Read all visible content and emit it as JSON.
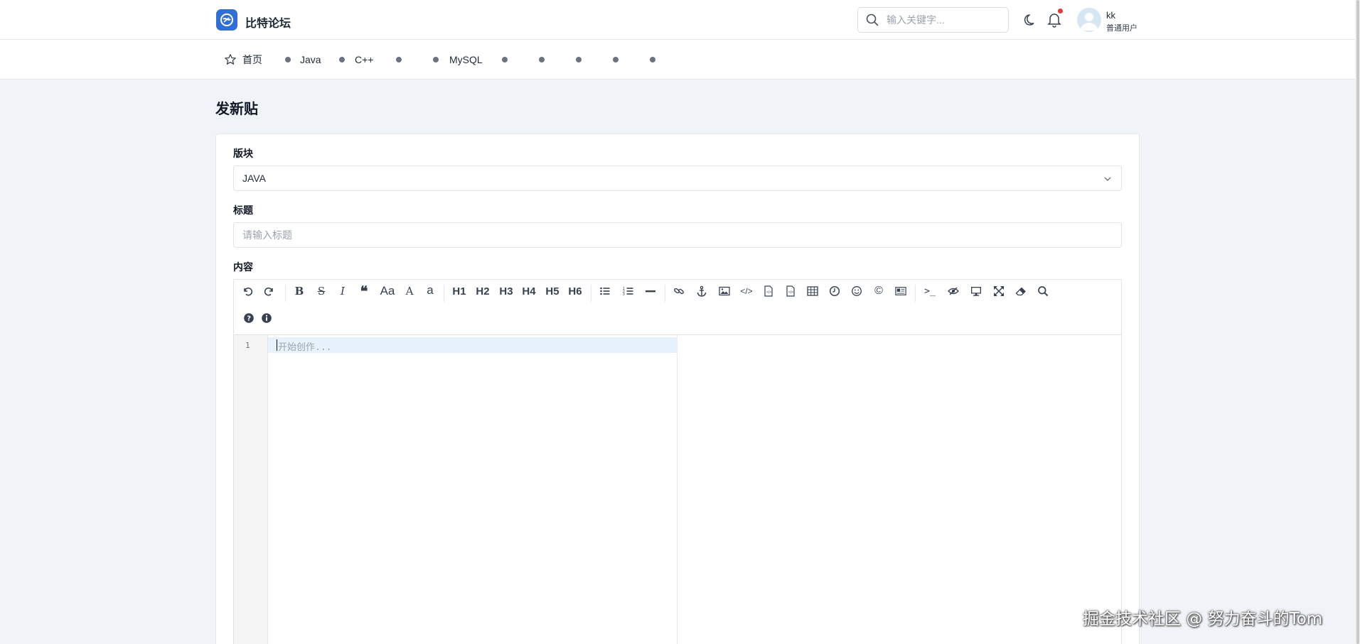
{
  "header": {
    "site_name": "比特论坛",
    "search_placeholder": "输入关键字...",
    "user": {
      "name": "kk",
      "role": "普通用户"
    },
    "notification_dot_color": "#e53935",
    "brand_color": "#2f6fd6"
  },
  "nav": {
    "home_label": "首页",
    "items": [
      "Java",
      "C++",
      "",
      "MySQL",
      "",
      "",
      "",
      "",
      ""
    ]
  },
  "page": {
    "title": "发新贴"
  },
  "form": {
    "board_label": "版块",
    "board_value": "JAVA",
    "title_label": "标题",
    "title_placeholder": "请输入标题",
    "content_label": "内容"
  },
  "editor": {
    "toolbar": [
      "undo-icon",
      "redo-icon",
      "bold-icon",
      "strikethrough-icon",
      "italic-icon",
      "quote-icon",
      "Aa",
      "A",
      "a",
      "H1",
      "H2",
      "H3",
      "H4",
      "H5",
      "H6",
      "unordered-list-icon",
      "ordered-list-icon",
      "hr-icon",
      "link-icon",
      "anchor-icon",
      "image-icon",
      "code-icon",
      "code-block-icon",
      "preformatted-icon",
      "table-icon",
      "datetime-icon",
      "emoji-icon",
      "html-entities-icon",
      "pagebreak-icon",
      "goto-line-icon",
      "watch-icon",
      "preview-icon",
      "fullscreen-icon",
      "clear-icon",
      "search-icon",
      "help-icon",
      "info-icon"
    ],
    "line_number": "1",
    "placeholder": "开始创作..."
  },
  "watermark": "掘金技术社区 @ 努力奋斗的Tom"
}
